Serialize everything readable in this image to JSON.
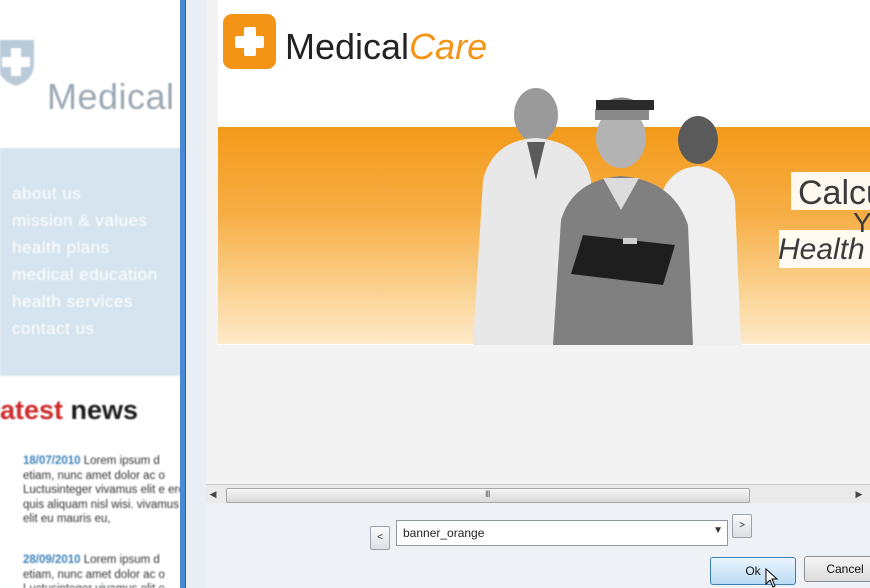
{
  "background_page": {
    "site_title": "Medical",
    "nav_items": [
      "about us",
      "mission & values",
      "health plans",
      "medical education",
      "health services",
      "contact us"
    ],
    "news_heading_red": "atest",
    "news_heading_dark": "news",
    "news": [
      {
        "date": "18/07/2010",
        "text": " Lorem ipsum d etiam, nunc amet dolor ac o Luctusinteger vivamus elit e eros quis aliquam nisl wisi. vivamus elit eu mauris eu,"
      },
      {
        "date": "28/09/2010",
        "text": " Lorem ipsum d etiam, nunc amet dolor ac o Luctusinteger vivamus elit e"
      }
    ],
    "colors": {
      "nav_bg": "#d5e4ee",
      "news_red": "#cf2b2b",
      "date_blue": "#3d82b8"
    }
  },
  "dialog": {
    "banner": {
      "brand_medical": "Medical",
      "brand_care": "Care",
      "headline_line1": "Calcu",
      "headline_line2": "Yo",
      "headline_line3": "Health",
      "colors": {
        "orange": "#f39417"
      }
    },
    "scroll_grip": "III",
    "selector": {
      "prev_label": "<",
      "next_label": ">",
      "selected_value": "banner_orange",
      "arrow": "▼"
    },
    "buttons": {
      "ok_label": "Ok",
      "cancel_label": "Cancel"
    }
  }
}
